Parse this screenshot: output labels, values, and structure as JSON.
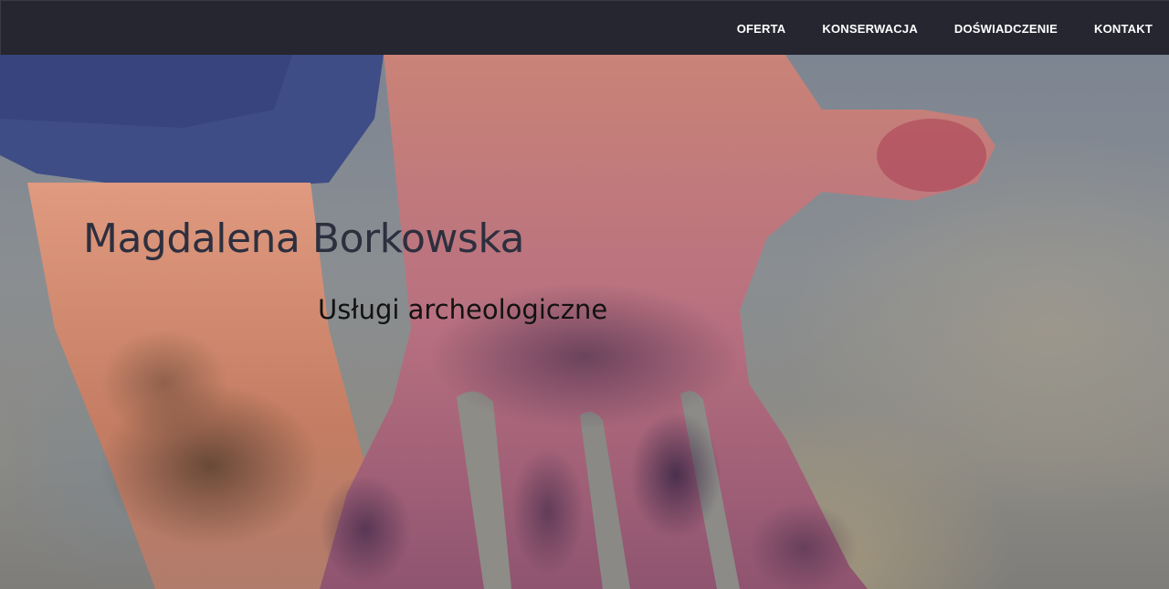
{
  "nav": {
    "items": [
      "OFERTA",
      "KONSERWACJA",
      "DOŚWIADCZENIE",
      "KONTAKT"
    ]
  },
  "hero": {
    "title": "Magdalena Borkowska",
    "subtitle": "Usługi archeologiczne",
    "image_description_icon": "hand-photo"
  },
  "colors": {
    "navbar_bg": "#262631",
    "nav_text": "#ffffff",
    "title_text": "#2d2f3e",
    "subtitle_text": "#121212"
  }
}
